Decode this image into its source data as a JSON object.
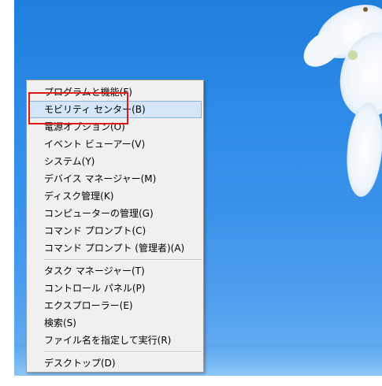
{
  "menu": {
    "items": [
      {
        "label": "プログラムと機能(F)",
        "selected": false
      },
      {
        "label": "モビリティ センター(B)",
        "selected": true
      },
      {
        "label": "電源オプション(O)",
        "selected": false
      },
      {
        "label": "イベント ビューアー(V)",
        "selected": false
      },
      {
        "label": "システム(Y)",
        "selected": false
      },
      {
        "label": "デバイス マネージャー(M)",
        "selected": false
      },
      {
        "label": "ディスク管理(K)",
        "selected": false
      },
      {
        "label": "コンピューターの管理(G)",
        "selected": false
      },
      {
        "label": "コマンド プロンプト(C)",
        "selected": false
      },
      {
        "label": "コマンド プロンプト (管理者)(A)",
        "selected": false
      },
      {
        "label": "タスク マネージャー(T)",
        "selected": false
      },
      {
        "label": "コントロール パネル(P)",
        "selected": false
      },
      {
        "label": "エクスプローラー(E)",
        "selected": false
      },
      {
        "label": "検索(S)",
        "selected": false
      },
      {
        "label": "ファイル名を指定して実行(R)",
        "selected": false
      },
      {
        "label": "デスクトップ(D)",
        "selected": false
      }
    ]
  },
  "colors": {
    "desktop_blue": "#2e8ae6",
    "menu_bg": "#f0f0f0",
    "selected_bg": "#d5e6f8",
    "highlight_box": "#e01818"
  }
}
